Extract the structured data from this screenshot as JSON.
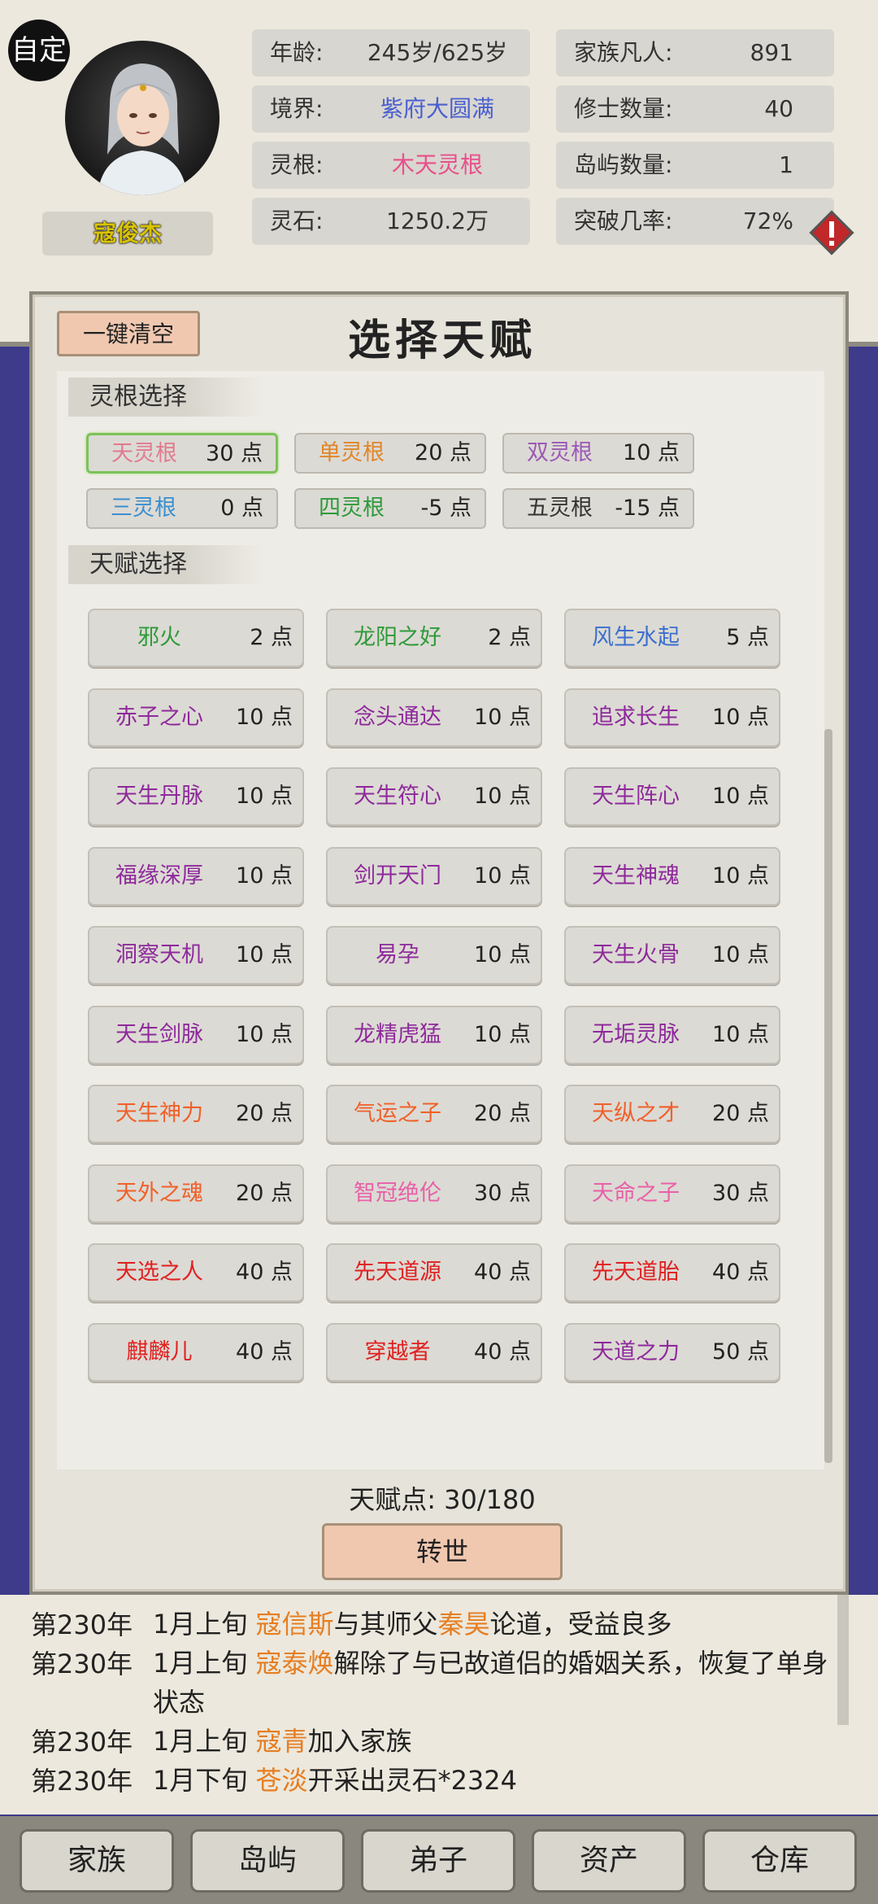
{
  "header": {
    "auto_label": "自定",
    "character_name": "寇俊杰",
    "stats_left": [
      {
        "key": "年龄:",
        "value": "245岁/625岁",
        "color": "#333333"
      },
      {
        "key": "境界:",
        "value": "紫府大圆满",
        "color": "#4a5fd0"
      },
      {
        "key": "灵根:",
        "value": "木天灵根",
        "color": "#e8508c"
      },
      {
        "key": "灵石:",
        "value": "1250.2万",
        "color": "#333333"
      }
    ],
    "stats_right": [
      {
        "key": "家族凡人:",
        "value": "891"
      },
      {
        "key": "修士数量:",
        "value": "40"
      },
      {
        "key": "岛屿数量:",
        "value": "1"
      },
      {
        "key": "突破几率:",
        "value": "72%"
      }
    ],
    "warning_icon": "exclamation-diamond-icon"
  },
  "modal": {
    "clear_button": "一键清空",
    "title": "选择天赋",
    "root_section_label": "灵根选择",
    "talent_section_label": "天赋选择",
    "roots": [
      {
        "name": "天灵根",
        "points": "30 点",
        "color": "#e07a8f",
        "selected": true
      },
      {
        "name": "单灵根",
        "points": "20 点",
        "color": "#e0862a",
        "selected": false
      },
      {
        "name": "双灵根",
        "points": "10 点",
        "color": "#9b59b6",
        "selected": false
      },
      {
        "name": "三灵根",
        "points": "0 点",
        "color": "#3a8fd0",
        "selected": false
      },
      {
        "name": "四灵根",
        "points": "-5 点",
        "color": "#2e9a3a",
        "selected": false
      },
      {
        "name": "五灵根",
        "points": "-15 点",
        "color": "#333333",
        "selected": false
      }
    ],
    "talents": [
      {
        "name": "邪火",
        "points": "2 点",
        "color": "#2e9a3a"
      },
      {
        "name": "龙阳之好",
        "points": "2 点",
        "color": "#2e9a3a"
      },
      {
        "name": "风生水起",
        "points": "5 点",
        "color": "#3a6fd0"
      },
      {
        "name": "赤子之心",
        "points": "10 点",
        "color": "#8e2a9c"
      },
      {
        "name": "念头通达",
        "points": "10 点",
        "color": "#8e2a9c"
      },
      {
        "name": "追求长生",
        "points": "10 点",
        "color": "#8e2a9c"
      },
      {
        "name": "天生丹脉",
        "points": "10 点",
        "color": "#8e2a9c"
      },
      {
        "name": "天生符心",
        "points": "10 点",
        "color": "#8e2a9c"
      },
      {
        "name": "天生阵心",
        "points": "10 点",
        "color": "#8e2a9c"
      },
      {
        "name": "福缘深厚",
        "points": "10 点",
        "color": "#8e2a9c"
      },
      {
        "name": "剑开天门",
        "points": "10 点",
        "color": "#8e2a9c"
      },
      {
        "name": "天生神魂",
        "points": "10 点",
        "color": "#8e2a9c"
      },
      {
        "name": "洞察天机",
        "points": "10 点",
        "color": "#8e2a9c"
      },
      {
        "name": "易孕",
        "points": "10 点",
        "color": "#8e2a9c"
      },
      {
        "name": "天生火骨",
        "points": "10 点",
        "color": "#8e2a9c"
      },
      {
        "name": "天生剑脉",
        "points": "10 点",
        "color": "#8e2a9c"
      },
      {
        "name": "龙精虎猛",
        "points": "10 点",
        "color": "#8e2a9c"
      },
      {
        "name": "无垢灵脉",
        "points": "10 点",
        "color": "#8e2a9c"
      },
      {
        "name": "天生神力",
        "points": "20 点",
        "color": "#f0602a"
      },
      {
        "name": "气运之子",
        "points": "20 点",
        "color": "#f0602a"
      },
      {
        "name": "天纵之才",
        "points": "20 点",
        "color": "#f0602a"
      },
      {
        "name": "天外之魂",
        "points": "20 点",
        "color": "#f0602a"
      },
      {
        "name": "智冠绝伦",
        "points": "30 点",
        "color": "#e860a8"
      },
      {
        "name": "天命之子",
        "points": "30 点",
        "color": "#e860a8"
      },
      {
        "name": "天选之人",
        "points": "40 点",
        "color": "#e02020"
      },
      {
        "name": "先天道源",
        "points": "40 点",
        "color": "#e02020"
      },
      {
        "name": "先天道胎",
        "points": "40 点",
        "color": "#e02020"
      },
      {
        "name": "麒麟儿",
        "points": "40 点",
        "color": "#e02020"
      },
      {
        "name": "穿越者",
        "points": "40 点",
        "color": "#e02020"
      },
      {
        "name": "天道之力",
        "points": "50 点",
        "color": "#8e2a9c"
      }
    ],
    "talent_points_text": "天赋点: 30/180",
    "rebirth_button": "转世"
  },
  "log": [
    {
      "year": "第230年",
      "parts": [
        "1月上旬 ",
        "寇信斯",
        "与其师父",
        "秦昊",
        "论道，受益良多"
      ]
    },
    {
      "year": "第230年",
      "parts": [
        "1月上旬 ",
        "寇泰焕",
        "解除了与已故道侣的婚姻关系，恢复了单身状态"
      ]
    },
    {
      "year": "第230年",
      "parts": [
        "1月上旬 ",
        "寇青",
        "加入家族"
      ]
    },
    {
      "year": "第230年",
      "parts": [
        "1月下旬 ",
        "苍淡",
        "开采出灵石*2324"
      ]
    }
  ],
  "nav": [
    "家族",
    "岛屿",
    "弟子",
    "资产",
    "仓库"
  ]
}
